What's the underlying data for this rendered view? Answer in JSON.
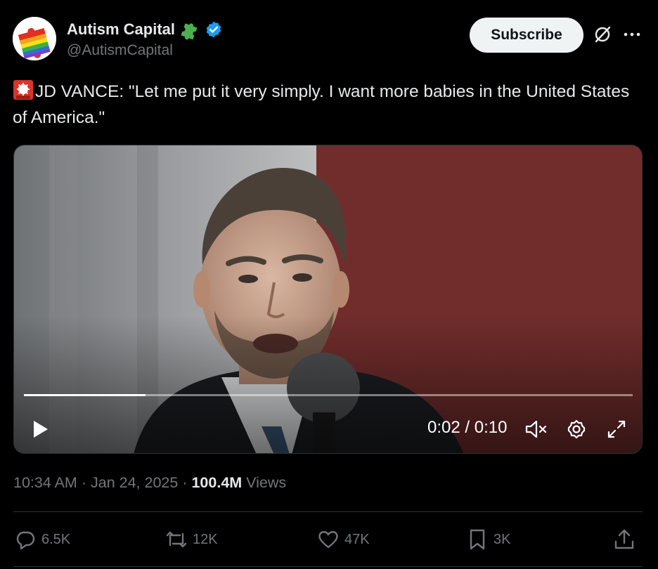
{
  "account": {
    "display_name": "Autism Capital",
    "handle": "@AutismCapital",
    "verified": true
  },
  "header": {
    "subscribe_label": "Subscribe"
  },
  "tweet": {
    "text": "JD VANCE: \"Let me put it very simply. I want more babies in the United States of America.\""
  },
  "video": {
    "time_display": "0:02 / 0:10",
    "progress_fraction": 0.2
  },
  "meta": {
    "time": "10:34 AM",
    "separator": "·",
    "date": "Jan 24, 2025",
    "views_count": "100.4M",
    "views_label": "Views"
  },
  "actions": {
    "replies": "6.5K",
    "reposts": "12K",
    "likes": "47K",
    "bookmarks": "3K"
  },
  "colors": {
    "background": "#000000",
    "text": "#e7e9ea",
    "muted": "#71767b",
    "verified": "#1d9bf0",
    "divider": "#2f3336"
  },
  "icons": [
    "puzzle-avatar",
    "puzzle-badge-icon",
    "verified-badge-icon",
    "grok-icon",
    "more-icon",
    "siren-emoji-icon",
    "play-icon",
    "mute-icon",
    "settings-icon",
    "fullscreen-icon",
    "reply-icon",
    "repost-icon",
    "like-icon",
    "bookmark-icon",
    "share-icon"
  ]
}
